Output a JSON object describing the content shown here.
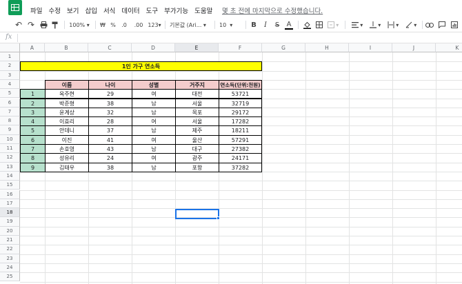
{
  "menu": {
    "items": [
      "파일",
      "수정",
      "보기",
      "삽입",
      "서식",
      "데이터",
      "도구",
      "부가기능",
      "도움말"
    ],
    "last_edit": "몇 초 전에 마지막으로 수정했습니다."
  },
  "toolbar": {
    "zoom": "100%",
    "currency": "₩",
    "percent": "%",
    "dec_less": ".0",
    "dec_more": ".00",
    "number_format": "123▾",
    "font": "기본값 (Ari...",
    "font_size": "10",
    "bold": "B",
    "italic": "I",
    "strike": "S",
    "text_color": "A"
  },
  "formula": {
    "fx": "fx"
  },
  "columns": [
    "A",
    "B",
    "C",
    "D",
    "E",
    "F",
    "G",
    "H",
    "I",
    "J",
    "K"
  ],
  "rows": [
    "1",
    "2",
    "3",
    "4",
    "5",
    "6",
    "7",
    "8",
    "9",
    "10",
    "11",
    "12",
    "13",
    "14",
    "15",
    "16",
    "17",
    "18",
    "19",
    "20",
    "21",
    "22",
    "23",
    "24",
    "25"
  ],
  "sheet": {
    "title": "1인 가구 연소득",
    "headers": [
      "이름",
      "나이",
      "성별",
      "거주지",
      "연소득(단위:천원)"
    ],
    "records": [
      {
        "no": "1",
        "name": "옥주현",
        "age": "29",
        "gender": "여",
        "city": "대전",
        "income": "53721"
      },
      {
        "no": "2",
        "name": "박준형",
        "age": "38",
        "gender": "남",
        "city": "서울",
        "income": "32719"
      },
      {
        "no": "3",
        "name": "윤계상",
        "age": "32",
        "gender": "남",
        "city": "목포",
        "income": "29172"
      },
      {
        "no": "4",
        "name": "이효리",
        "age": "28",
        "gender": "여",
        "city": "서울",
        "income": "17282"
      },
      {
        "no": "5",
        "name": "안데니",
        "age": "37",
        "gender": "남",
        "city": "제주",
        "income": "18211"
      },
      {
        "no": "6",
        "name": "이진",
        "age": "41",
        "gender": "여",
        "city": "울산",
        "income": "57291"
      },
      {
        "no": "7",
        "name": "손호영",
        "age": "43",
        "gender": "남",
        "city": "대구",
        "income": "27382"
      },
      {
        "no": "8",
        "name": "성유리",
        "age": "24",
        "gender": "여",
        "city": "광주",
        "income": "24171"
      },
      {
        "no": "9",
        "name": "김태우",
        "age": "38",
        "gender": "남",
        "city": "포항",
        "income": "37282"
      }
    ]
  },
  "colors": {
    "title_bg": "#ffff00",
    "header_bg": "#f4cccc",
    "number_bg": "#b7e1cd",
    "selection": "#1a73e8",
    "logo": "#0f9d58"
  },
  "selected_cell": "E18"
}
